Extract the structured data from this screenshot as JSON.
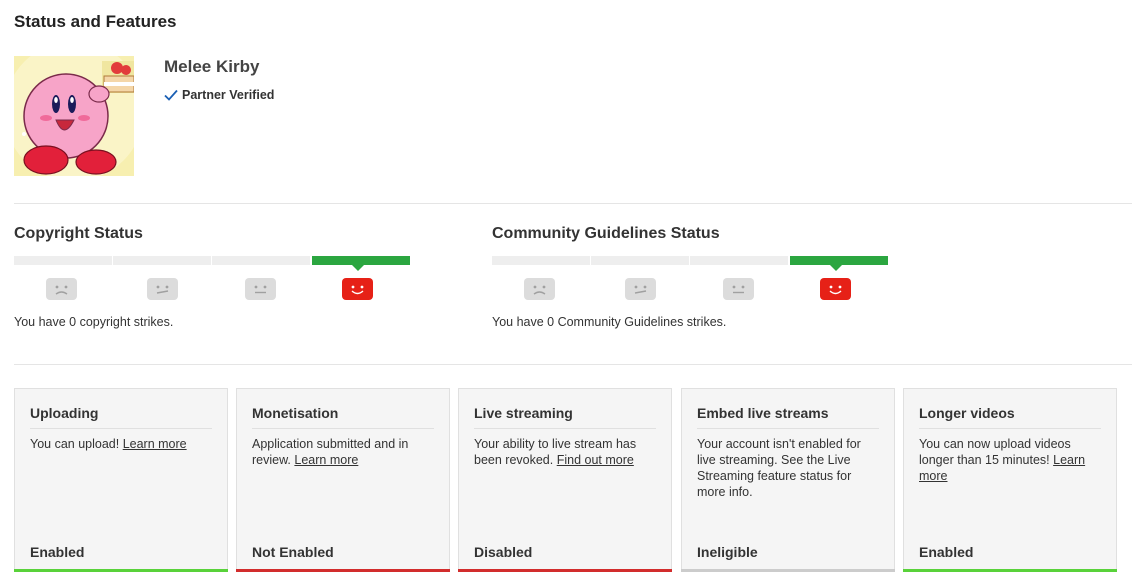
{
  "page": {
    "title": "Status and Features"
  },
  "channel": {
    "name": "Melee Kirby",
    "verified_label": "Partner Verified"
  },
  "copyright": {
    "title": "Copyright Status",
    "strike_text": "You have 0 copyright strikes.",
    "active_segment": 4
  },
  "community": {
    "title": "Community Guidelines Status",
    "strike_text": "You have 0 Community Guidelines strikes.",
    "active_segment": 4
  },
  "colors": {
    "enabled": "#59d23a",
    "not_enabled": "#d22d2d",
    "ineligible": "#cccccc",
    "status_green": "#2ba640",
    "face_red": "#e62117"
  },
  "features": [
    {
      "title": "Uploading",
      "desc": "You can upload! ",
      "link": "Learn more",
      "state": "Enabled",
      "color": "#59d23a"
    },
    {
      "title": "Monetisation",
      "desc": "Application submitted and in review. ",
      "link": "Learn more",
      "state": "Not Enabled",
      "color": "#d22d2d"
    },
    {
      "title": "Live streaming",
      "desc": "Your ability to live stream has been revoked. ",
      "link": "Find out more",
      "state": "Disabled",
      "color": "#d22d2d"
    },
    {
      "title": "Embed live streams",
      "desc": "Your account isn't enabled for live streaming. See the Live Streaming feature status for more info.",
      "link": "",
      "state": "Ineligible",
      "color": "#cccccc"
    },
    {
      "title": "Longer videos",
      "desc": "You can now upload videos longer than 15 minutes! ",
      "link": "Learn more",
      "state": "Enabled",
      "color": "#59d23a"
    }
  ]
}
